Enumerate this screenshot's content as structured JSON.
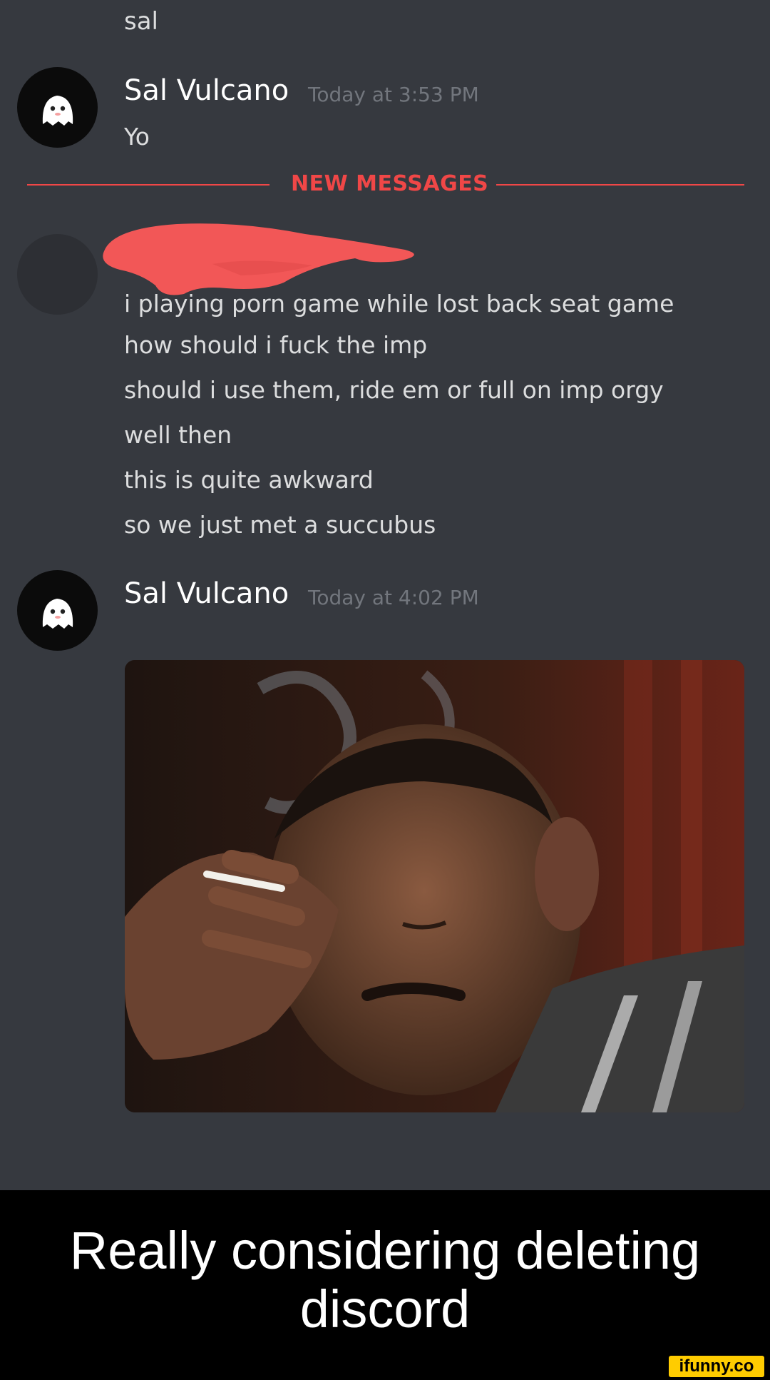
{
  "chat": {
    "previous_message": "sal",
    "messages": [
      {
        "username": "Sal Vulcano",
        "timestamp": "Today at 3:53 PM",
        "lines": [
          "Yo"
        ]
      },
      {
        "username": "",
        "timestamp": "",
        "lines": [
          "i playing porn game while lost back seat game",
          "how should i fuck the imp",
          "should i use them, ride em or full on imp orgy",
          "well then",
          "this is quite awkward",
          "so we just met a succubus"
        ]
      },
      {
        "username": "Sal Vulcano",
        "timestamp": "Today at 4:02 PM",
        "lines": []
      }
    ],
    "new_messages_label": "NEW MESSAGES",
    "colors": {
      "background": "#36393f",
      "new_messages": "#f04747",
      "redaction": "#f25757",
      "timestamp": "#72767d"
    }
  },
  "icons": {
    "avatar": "ghost-avatar-icon",
    "redaction": "red-scribble-redaction"
  },
  "caption": {
    "line1": "Really considering deleting",
    "line2": "discord"
  },
  "watermark": "ifunny.co"
}
